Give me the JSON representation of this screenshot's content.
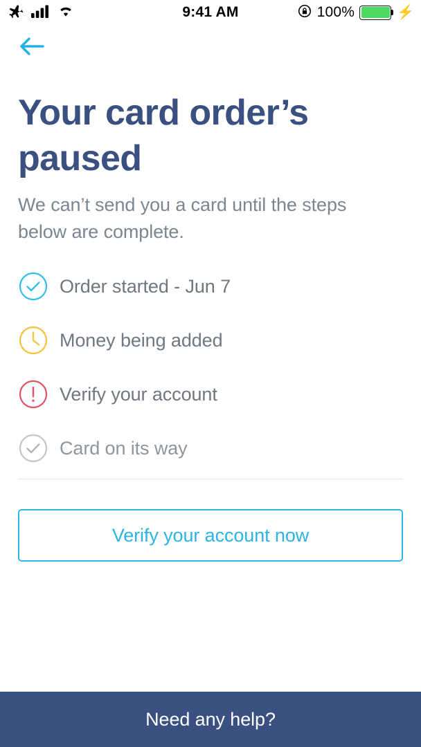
{
  "status_bar": {
    "airplane_icon": "airplane-icon",
    "signal_icon": "cellular-signal-icon",
    "wifi_icon": "wifi-icon",
    "time": "9:41 AM",
    "rotation_lock_icon": "rotation-lock-icon",
    "battery_percent": "100%",
    "battery_icon": "battery-full-icon",
    "charging_icon": "lightning-bolt-icon"
  },
  "nav": {
    "back_icon": "arrow-left-icon"
  },
  "screen": {
    "headline": "Your card order’s paused",
    "subtitle": "We can’t send you a card until the steps below are complete."
  },
  "steps": [
    {
      "label": "Order started - Jun 7",
      "icon": "check-circle-icon",
      "state": "complete",
      "color": "#2FC0E8"
    },
    {
      "label": "Money being added",
      "icon": "clock-circle-icon",
      "state": "in-progress",
      "color": "#F2C23C"
    },
    {
      "label": "Verify your account",
      "icon": "alert-circle-icon",
      "state": "action",
      "color": "#E15361"
    },
    {
      "label": "Card on its way",
      "icon": "check-circle-icon",
      "state": "pending",
      "color": "#B9BEC4"
    }
  ],
  "cta": {
    "label": "Verify your account now"
  },
  "footer": {
    "label": "Need any help?"
  },
  "colors": {
    "accent_cyan": "#2BB4E4",
    "headline_navy": "#3A5080",
    "body_gray": "#7C8691",
    "footer_navy": "#3A5080",
    "divider": "#E6E8EA"
  }
}
